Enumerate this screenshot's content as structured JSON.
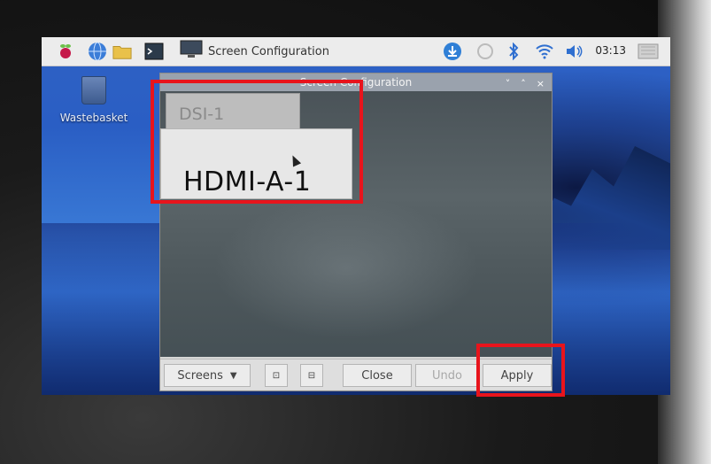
{
  "taskbar": {
    "window_title": "Screen Configuration",
    "clock": "03:13",
    "icons": [
      "raspberry-pi-menu-icon",
      "globe-icon",
      "folder-icon",
      "terminal-icon",
      "display-icon",
      "update-icon",
      "network-icon",
      "bluetooth-icon",
      "wifi-icon",
      "volume-icon",
      "eject-icon"
    ]
  },
  "desktop": {
    "wastebasket_label": "Wastebasket"
  },
  "dialog": {
    "title": "Screen Configuration",
    "controls": [
      "˅",
      "˄",
      "×"
    ],
    "monitors": {
      "dsi": "DSI-1",
      "hdmi": "HDMI-A-1"
    },
    "toolbar": {
      "screens_label": "Screens",
      "close_label": "Close",
      "undo_label": "Undo",
      "apply_label": "Apply"
    }
  },
  "colors": {
    "highlight": "#e8141c",
    "taskbar_bg": "#ececec",
    "desktop_blue": "#2f62c4"
  }
}
